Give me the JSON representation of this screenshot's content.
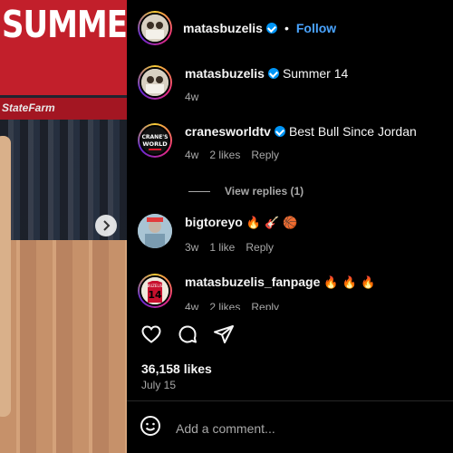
{
  "photo": {
    "banner_text": "SUMMER LEAGUE",
    "sponsor_text": "StateFarm"
  },
  "header": {
    "username": "matasbuzelis",
    "follow_label": "Follow",
    "separator": "•"
  },
  "comments": [
    {
      "username": "matasbuzelis",
      "text": "Summer 14",
      "time": "4w",
      "verified": true,
      "avatar_icon": "profile-photo-icon"
    },
    {
      "username": "cranesworldtv",
      "text": "Best Bull Since Jordan",
      "time": "4w",
      "likes": "2 likes",
      "reply_label": "Reply",
      "verified": true,
      "avatar_text": "CRANE'S WORLD",
      "avatar_icon": "cranes-world-logo-icon"
    },
    {
      "username": "bigtoreyo",
      "emojis": "🔥 🎸 🏀",
      "time": "3w",
      "likes": "1 like",
      "reply_label": "Reply",
      "avatar_icon": "profile-photo-icon"
    },
    {
      "username": "matasbuzelis_fanpage",
      "emojis": "🔥 🔥 🔥",
      "time": "4w",
      "likes": "2 likes",
      "reply_label": "Reply",
      "avatar_text": "14",
      "avatar_icon": "jersey-14-icon"
    }
  ],
  "view_replies": "View replies (1)",
  "post": {
    "likes": "36,158 likes",
    "date": "July 15"
  },
  "add_comment": {
    "placeholder": "Add a comment..."
  },
  "colors": {
    "accent": "#0095f6",
    "follow": "#4aa4ff",
    "muted": "#a8a8a8",
    "background": "#000000"
  }
}
